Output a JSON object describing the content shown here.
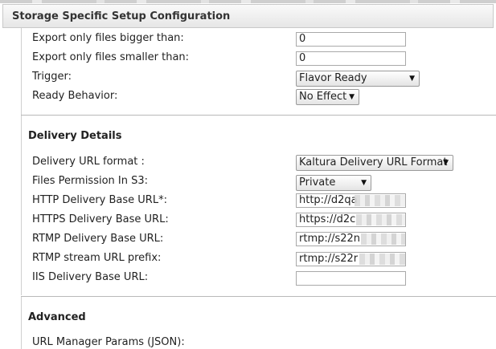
{
  "header": {
    "title": "Storage Specific Setup Configuration"
  },
  "fields": {
    "export_bigger": {
      "label": "Export only files bigger than:",
      "value": "0"
    },
    "export_smaller": {
      "label": "Export only files smaller than:",
      "value": "0"
    },
    "trigger": {
      "label": "Trigger:",
      "selected": "Flavor Ready"
    },
    "ready_behavior": {
      "label": "Ready Behavior:",
      "selected": "No Effect"
    }
  },
  "delivery": {
    "title": "Delivery Details",
    "url_format": {
      "label": "Delivery URL format :",
      "selected": "Kaltura Delivery URL Format"
    },
    "files_permission": {
      "label": "Files Permission In S3:",
      "selected": "Private"
    },
    "http_base": {
      "label": "HTTP Delivery Base URL*:",
      "value": "http://d2qa"
    },
    "https_base": {
      "label": "HTTPS Delivery Base URL:",
      "value": "https://d2c"
    },
    "rtmp_base": {
      "label": "RTMP Delivery Base URL:",
      "value": "rtmp://s22n"
    },
    "rtmp_prefix": {
      "label": "RTMP stream URL prefix:",
      "value": "rtmp://s22r"
    },
    "iis_base": {
      "label": "IIS Delivery Base URL:",
      "value": ""
    }
  },
  "advanced": {
    "title": "Advanced",
    "url_manager": {
      "label": "URL Manager Params (JSON):"
    }
  },
  "icons": {
    "dropdown": "triangle-down-icon"
  }
}
